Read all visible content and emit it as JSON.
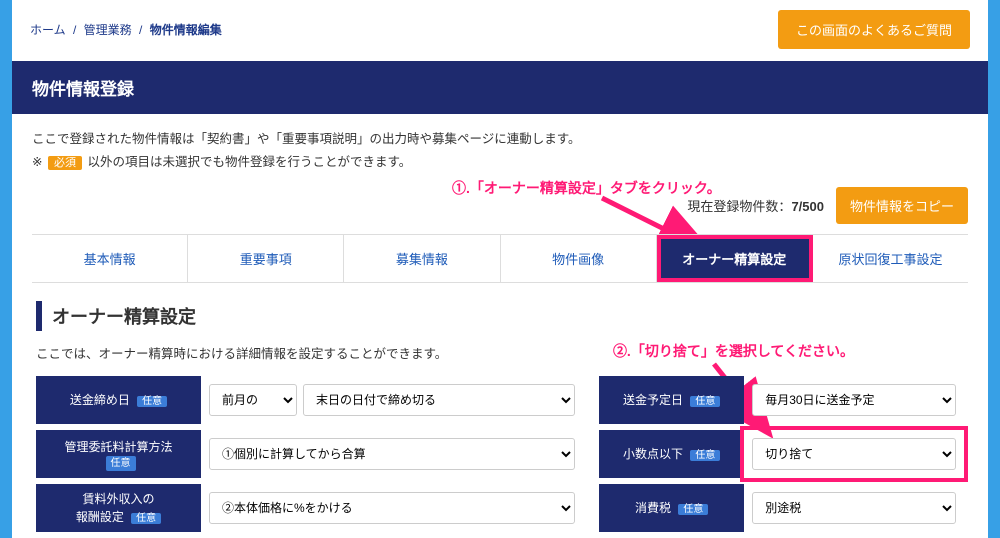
{
  "breadcrumb": {
    "home": "ホーム",
    "mgmt": "管理業務",
    "current": "物件情報編集"
  },
  "header": {
    "faq_btn": "この画面のよくあるご質問",
    "title": "物件情報登録"
  },
  "desc": {
    "line1": "ここで登録された物件情報は「契約書」や「重要事項説明」の出力時や募集ページに連動します。",
    "prefix": "※",
    "required": "必須",
    "line2": "以外の項目は未選択でも物件登録を行うことができます。"
  },
  "count": {
    "label": "現在登録物件数：",
    "value": "7/500",
    "copy_btn": "物件情報をコピー"
  },
  "tabs": [
    "基本情報",
    "重要事項",
    "募集情報",
    "物件画像",
    "オーナー精算設定",
    "原状回復工事設定"
  ],
  "annotations": {
    "a1": "①.「オーナー精算設定」タブをクリック。",
    "a2": "②.「切り捨て」を選択してください。"
  },
  "section": {
    "title": "オーナー精算設定",
    "desc": "ここでは、オーナー精算時における詳細情報を設定することができます。"
  },
  "form": {
    "opt": "任意",
    "left": [
      {
        "label": "送金締め日",
        "selects": [
          "前月の",
          "末日の日付で締め切る"
        ],
        "narrow_first": true
      },
      {
        "label": "管理委託料計算方法",
        "selects": [
          "①個別に計算してから合算"
        ]
      },
      {
        "label": "賃料外収入の\n報酬設定",
        "selects": [
          "②本体価格に%をかける"
        ]
      }
    ],
    "right": [
      {
        "label": "送金予定日",
        "selects": [
          "毎月30日に送金予定"
        ]
      },
      {
        "label": "小数点以下",
        "selects": [
          "切り捨て"
        ],
        "highlight": true
      },
      {
        "label": "消費税",
        "selects": [
          "別途税"
        ]
      }
    ]
  }
}
